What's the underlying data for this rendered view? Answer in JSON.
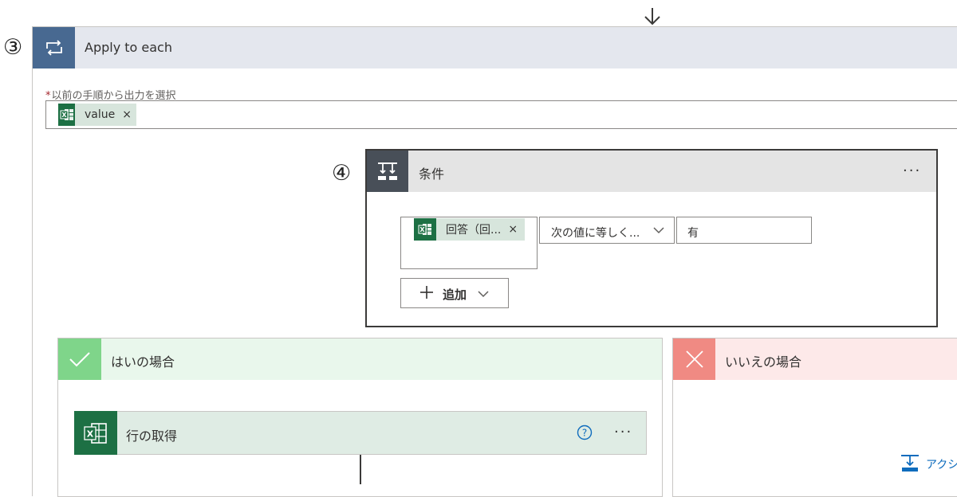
{
  "step_markers": {
    "loop": "③",
    "condition": "④"
  },
  "loop": {
    "title": "Apply to each",
    "icon": "loop-icon",
    "select_label_required": "*",
    "select_label": "以前の手順から出力を選択",
    "token": {
      "label": "value",
      "close": "×",
      "icon": "excel-icon"
    }
  },
  "condition": {
    "title": "条件",
    "icon": "condition-icon",
    "more": "···",
    "left_token": {
      "label": "回答（回...",
      "close": "×",
      "icon": "excel-icon"
    },
    "operator": "次の値に等しく...",
    "value": "有",
    "add_label": "追加"
  },
  "yes_branch": {
    "title": "はいの場合",
    "icon": "check-icon",
    "action": {
      "title": "行の取得",
      "icon": "excel-icon",
      "more": "···"
    }
  },
  "no_branch": {
    "title": "いいえの場合",
    "icon": "close-icon",
    "add_action_label": "アクシ"
  },
  "colors": {
    "loop_accent": "#486991",
    "condition_accent": "#484f58",
    "excel_green": "#1d7044",
    "yes_accent": "#7fd58a",
    "no_accent": "#f08a83",
    "link_blue": "#0f6cbd"
  }
}
